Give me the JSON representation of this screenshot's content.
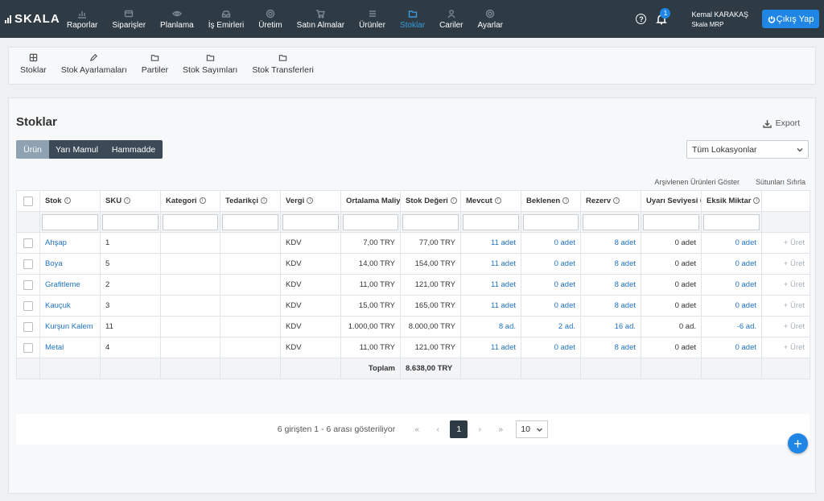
{
  "brand": {
    "name": "SKALA"
  },
  "nav": {
    "items": [
      {
        "label": "Raporlar",
        "icon": "chart-icon"
      },
      {
        "label": "Siparişler",
        "icon": "orders-icon"
      },
      {
        "label": "Planlama",
        "icon": "eye-icon"
      },
      {
        "label": "İş Emirleri",
        "icon": "inbox-icon"
      },
      {
        "label": "Üretim",
        "icon": "gear-icon"
      },
      {
        "label": "Satın Almalar",
        "icon": "cart-icon"
      },
      {
        "label": "Ürünler",
        "icon": "list-icon"
      },
      {
        "label": "Stoklar",
        "icon": "folder-icon"
      },
      {
        "label": "Cariler",
        "icon": "user-icon"
      },
      {
        "label": "Ayarlar",
        "icon": "gear-icon"
      }
    ],
    "active_index": 7
  },
  "header": {
    "notification_count": "1",
    "user_name": "Kemal KARAKAŞ",
    "company": "Skala MRP",
    "logout_label": "Çıkış Yap"
  },
  "subnav": {
    "items": [
      {
        "label": "Stoklar",
        "icon": "grid-icon"
      },
      {
        "label": "Stok Ayarlamaları",
        "icon": "pencil-icon"
      },
      {
        "label": "Partiler",
        "icon": "folder-icon"
      },
      {
        "label": "Stok Sayımları",
        "icon": "folder-icon"
      },
      {
        "label": "Stok Transferleri",
        "icon": "folder-icon"
      }
    ]
  },
  "main": {
    "title": "Stoklar",
    "export_label": "Export",
    "segments": [
      "Ürün",
      "Yarı Mamul",
      "Hammadde"
    ],
    "location_select": "Tüm Lokasyonlar",
    "archived_link": "Arşivlenen Ürünleri Göster",
    "reset_columns_link": "Sütunları Sıfırla"
  },
  "table": {
    "columns": [
      "Stok",
      "SKU",
      "Kategori",
      "Tedarikçi",
      "Vergi",
      "Ortalama Maliyet",
      "Stok Değeri",
      "Mevcut",
      "Beklenen",
      "Rezerv",
      "Uyarı Seviyesi",
      "Eksik Miktar"
    ],
    "action_label": "Üret",
    "rows": [
      {
        "stok": "Ahşap",
        "sku": "1",
        "kategori": "",
        "tedarikci": "",
        "vergi": "KDV",
        "maliyet": "7,00 TRY",
        "deger": "77,00 TRY",
        "mevcut": "11 adet",
        "beklenen": "0 adet",
        "rezerv": "8 adet",
        "uyari": "0 adet",
        "eksik": "0 adet"
      },
      {
        "stok": "Boya",
        "sku": "5",
        "kategori": "",
        "tedarikci": "",
        "vergi": "KDV",
        "maliyet": "14,00 TRY",
        "deger": "154,00 TRY",
        "mevcut": "11 adet",
        "beklenen": "0 adet",
        "rezerv": "8 adet",
        "uyari": "0 adet",
        "eksik": "0 adet"
      },
      {
        "stok": "Grafitleme",
        "sku": "2",
        "kategori": "",
        "tedarikci": "",
        "vergi": "KDV",
        "maliyet": "11,00 TRY",
        "deger": "121,00 TRY",
        "mevcut": "11 adet",
        "beklenen": "0 adet",
        "rezerv": "8 adet",
        "uyari": "0 adet",
        "eksik": "0 adet"
      },
      {
        "stok": "Kauçuk",
        "sku": "3",
        "kategori": "",
        "tedarikci": "",
        "vergi": "KDV",
        "maliyet": "15,00 TRY",
        "deger": "165,00 TRY",
        "mevcut": "11 adet",
        "beklenen": "0 adet",
        "rezerv": "8 adet",
        "uyari": "0 adet",
        "eksik": "0 adet"
      },
      {
        "stok": "Kurşun Kalem",
        "sku": "11",
        "kategori": "",
        "tedarikci": "",
        "vergi": "KDV",
        "maliyet": "1.000,00 TRY",
        "deger": "8.000,00 TRY",
        "mevcut": "8 ad.",
        "beklenen": "2 ad.",
        "rezerv": "16 ad.",
        "uyari": "0 ad.",
        "eksik": "-6 ad."
      },
      {
        "stok": "Metal",
        "sku": "4",
        "kategori": "",
        "tedarikci": "",
        "vergi": "KDV",
        "maliyet": "11,00 TRY",
        "deger": "121,00 TRY",
        "mevcut": "11 adet",
        "beklenen": "0 adet",
        "rezerv": "8 adet",
        "uyari": "0 adet",
        "eksik": "0 adet"
      }
    ],
    "total_label": "Toplam",
    "total_value": "8.638,00 TRY"
  },
  "pagination": {
    "summary": "6 girişten 1 - 6 arası gösteriliyor",
    "current_page": "1",
    "page_size": "10"
  },
  "colors": {
    "topbar": "#2e3b45",
    "accent": "#1f86e6",
    "link": "#1f72c4"
  }
}
